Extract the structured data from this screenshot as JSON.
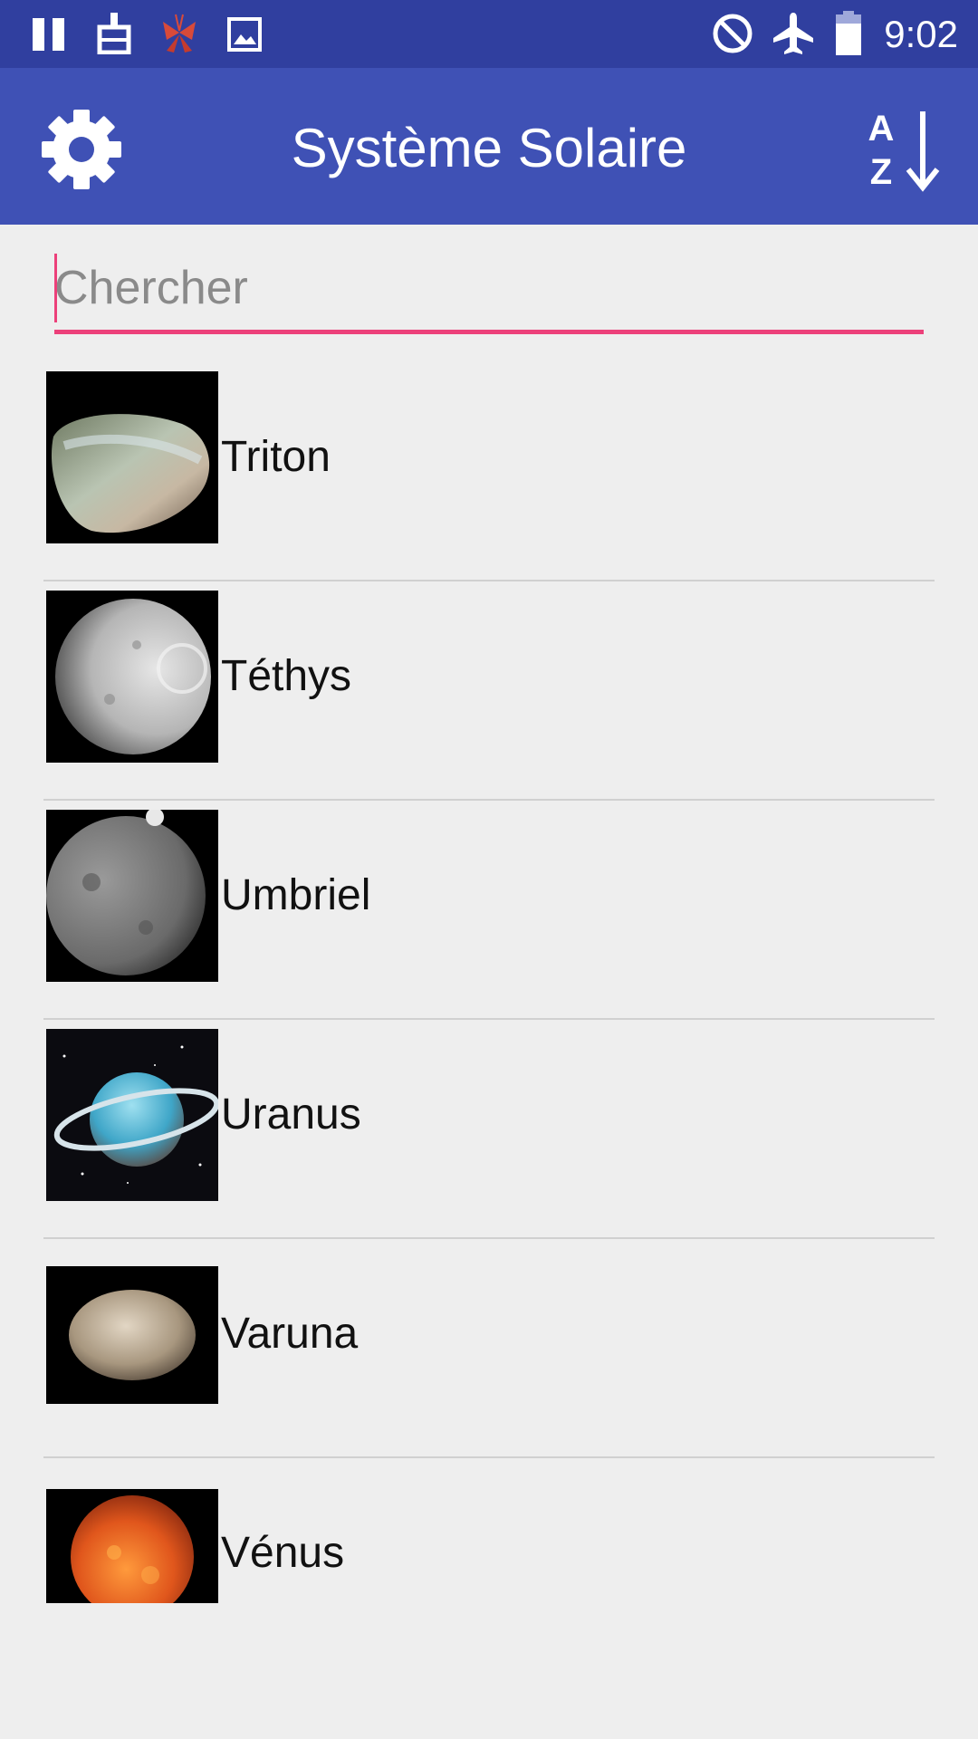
{
  "status_bar": {
    "time": "9:02",
    "icons": [
      "pause-icon",
      "cleaner-icon",
      "butterfly-icon",
      "image-icon",
      "do-not-disturb-icon",
      "airplane-mode-icon",
      "battery-icon"
    ]
  },
  "app_bar": {
    "title": "Système Solaire",
    "settings_icon": "gear-icon",
    "sort_icon": "sort-az-icon",
    "sort_letters": {
      "top": "A",
      "bottom": "Z"
    }
  },
  "search": {
    "value": "",
    "placeholder": "Chercher"
  },
  "list": {
    "items": [
      {
        "name": "Triton",
        "image": "triton-image"
      },
      {
        "name": "Téthys",
        "image": "tethys-image"
      },
      {
        "name": "Umbriel",
        "image": "umbriel-image"
      },
      {
        "name": "Uranus",
        "image": "uranus-image"
      },
      {
        "name": "Varuna",
        "image": "varuna-image"
      },
      {
        "name": "Vénus",
        "image": "venus-image"
      }
    ]
  },
  "colors": {
    "status_bar": "#303f9f",
    "app_bar": "#3f51b5",
    "accent": "#ec407a",
    "background": "#eeeeee"
  }
}
